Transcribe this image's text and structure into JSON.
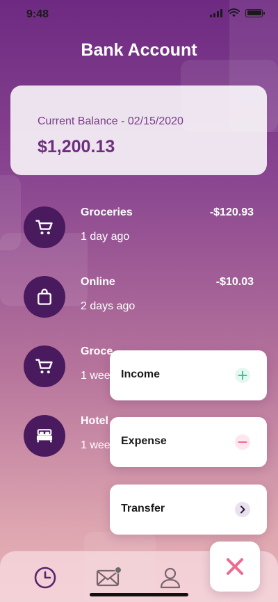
{
  "status_bar": {
    "time": "9:48"
  },
  "header": {
    "title": "Bank Account"
  },
  "balance": {
    "label": "Current Balance - 02/15/2020",
    "amount": "$1,200.13"
  },
  "transactions": [
    {
      "name": "Groceries",
      "time": "1 day ago",
      "amount": "-$120.93",
      "icon": "cart-icon"
    },
    {
      "name": "Online",
      "time": "2 days ago",
      "amount": "-$10.03",
      "icon": "shopping-bag-icon"
    },
    {
      "name": "Groce",
      "time": "1 wee",
      "amount": "",
      "icon": "cart-icon"
    },
    {
      "name": "Hotel",
      "time": "1 wee",
      "amount": "",
      "icon": "bed-icon"
    }
  ],
  "action_menu": {
    "items": [
      {
        "label": "Income",
        "icon": "plus-icon"
      },
      {
        "label": "Expense",
        "icon": "minus-icon"
      },
      {
        "label": "Transfer",
        "icon": "chevron-right-icon"
      }
    ]
  },
  "tab_bar": {
    "items": [
      {
        "icon": "clock-icon"
      },
      {
        "icon": "mail-icon"
      },
      {
        "icon": "user-icon"
      }
    ],
    "close_icon": "close-icon"
  },
  "colors": {
    "accent": "#6d2f7e",
    "icon_circle": "#4a1a5e",
    "income": "#3cc39a",
    "expense": "#f06b8f",
    "close": "#ef6a8d"
  }
}
